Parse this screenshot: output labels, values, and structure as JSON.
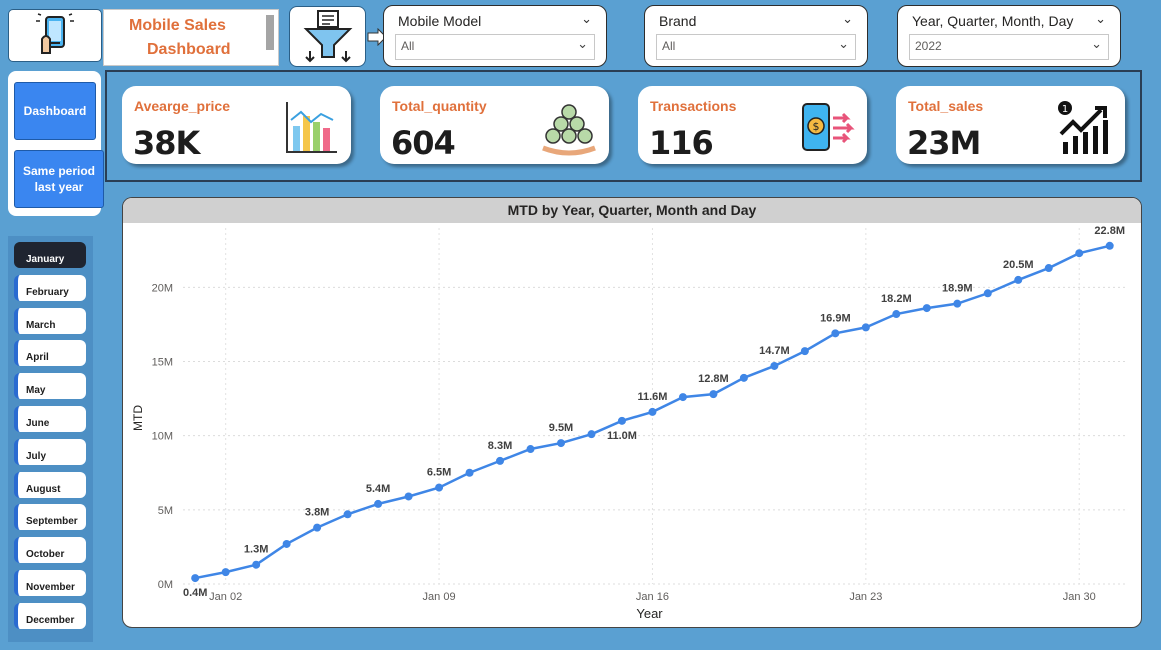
{
  "header": {
    "title_line1": "Mobile Sales",
    "title_line2": "Dashboard",
    "logo_icon": "phone-hand-icon",
    "filter_icon": "funnel-icon"
  },
  "slicers": [
    {
      "label": "Mobile Model",
      "value": "All"
    },
    {
      "label": "Brand",
      "value": "All"
    },
    {
      "label": "Year, Quarter, Month, Day",
      "value": "2022"
    }
  ],
  "nav": {
    "dashboard_label": "Dashboard",
    "same_period_label": "Same period last year"
  },
  "months": {
    "active": "January",
    "items": [
      "January",
      "February",
      "March",
      "April",
      "May",
      "June",
      "July",
      "August",
      "September",
      "October",
      "November",
      "December"
    ]
  },
  "kpis": [
    {
      "title": "Avearge_price",
      "value": "38K",
      "icon": "bar-chart-icon"
    },
    {
      "title": "Total_quantity",
      "value": "604",
      "icon": "money-bags-icon"
    },
    {
      "title": "Transactions",
      "value": "116",
      "icon": "mobile-payment-icon"
    },
    {
      "title": "Total_sales",
      "value": "23M",
      "icon": "growth-chart-icon"
    }
  ],
  "colors": {
    "background": "#5aa0d2",
    "accent_orange": "#e0703b",
    "line": "#3f86e6",
    "nav_button": "#3a86f0"
  },
  "chart_data": {
    "type": "line",
    "title": "MTD by Year, Quarter, Month and Day",
    "xlabel": "Year",
    "ylabel": "MTD",
    "ylim": [
      0,
      24
    ],
    "y_unit": "M",
    "yticks": [
      0,
      5,
      10,
      15,
      20
    ],
    "ytick_labels": [
      "0M",
      "5M",
      "10M",
      "15M",
      "20M"
    ],
    "xticks": [
      "Jan 02",
      "Jan 09",
      "Jan 16",
      "Jan 23",
      "Jan 30"
    ],
    "xtick_days": [
      2,
      9,
      16,
      23,
      30
    ],
    "x_days": [
      1,
      2,
      3,
      4,
      5,
      6,
      7,
      8,
      9,
      10,
      11,
      12,
      13,
      14,
      15,
      16,
      17,
      18,
      19,
      20,
      21,
      22,
      23,
      24,
      25,
      26,
      27,
      28,
      29,
      30,
      31
    ],
    "series": [
      {
        "values": [
          0.4,
          0.8,
          1.3,
          2.7,
          3.8,
          4.7,
          5.4,
          5.9,
          6.5,
          7.5,
          8.3,
          9.1,
          9.5,
          10.1,
          11.0,
          11.6,
          12.6,
          12.8,
          13.9,
          14.7,
          15.7,
          16.9,
          17.3,
          18.2,
          18.6,
          18.9,
          19.6,
          20.5,
          21.3,
          22.3,
          22.8
        ]
      }
    ],
    "data_labels": [
      {
        "day": 1,
        "text": "0.4M",
        "pos": "below"
      },
      {
        "day": 3,
        "text": "1.3M",
        "pos": "above"
      },
      {
        "day": 5,
        "text": "3.8M",
        "pos": "above"
      },
      {
        "day": 7,
        "text": "5.4M",
        "pos": "above"
      },
      {
        "day": 9,
        "text": "6.5M",
        "pos": "above"
      },
      {
        "day": 11,
        "text": "8.3M",
        "pos": "above"
      },
      {
        "day": 13,
        "text": "9.5M",
        "pos": "above"
      },
      {
        "day": 15,
        "text": "11.0M",
        "pos": "below"
      },
      {
        "day": 16,
        "text": "11.6M",
        "pos": "above"
      },
      {
        "day": 18,
        "text": "12.8M",
        "pos": "above"
      },
      {
        "day": 20,
        "text": "14.7M",
        "pos": "above"
      },
      {
        "day": 22,
        "text": "16.9M",
        "pos": "above"
      },
      {
        "day": 24,
        "text": "18.2M",
        "pos": "above"
      },
      {
        "day": 26,
        "text": "18.9M",
        "pos": "above"
      },
      {
        "day": 28,
        "text": "20.5M",
        "pos": "above"
      },
      {
        "day": 31,
        "text": "22.8M",
        "pos": "above"
      }
    ],
    "grid": true
  }
}
